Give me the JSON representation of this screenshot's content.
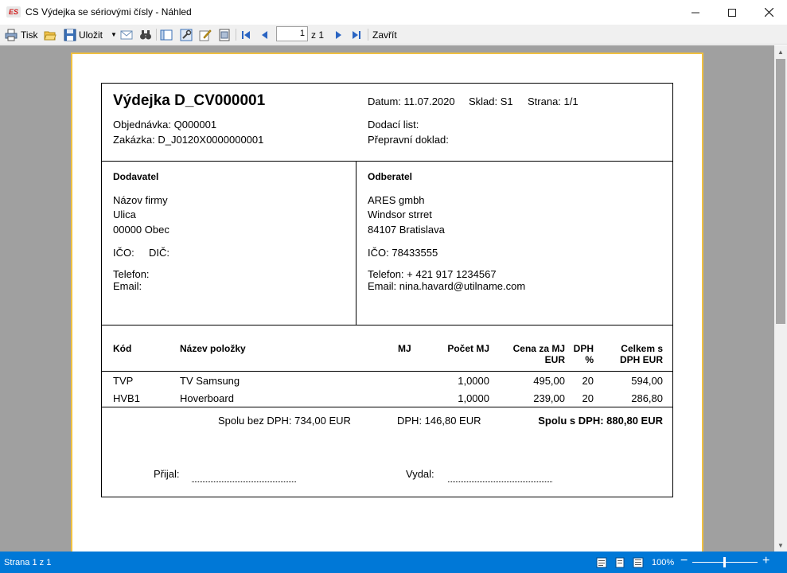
{
  "window": {
    "app_icon_text": "ES",
    "title": "CS Výdejka se sériovými čísly - Náhled"
  },
  "toolbar": {
    "print_label": "Tisk",
    "save_label": "Uložit",
    "page_input_value": "1",
    "page_of_label": "z 1",
    "close_label": "Zavřít"
  },
  "document": {
    "title": "Výdejka D_CV000001",
    "date_label": "Datum: 11.07.2020",
    "warehouse_label": "Sklad: S1",
    "page_label": "Strana: 1/1",
    "order_label": "Objednávka: Q000001",
    "contract_label": "Zakázka: D_J0120X0000000001",
    "delivery_note_label": "Dodací list:",
    "transport_doc_label": "Přepravní doklad:",
    "supplier": {
      "heading": "Dodavatel",
      "name": "Názov firmy",
      "street": "Ulica",
      "city": "00000 Obec",
      "ico": "IČO:",
      "dic": "DIČ:",
      "phone": "Telefon:",
      "email": "Email:"
    },
    "customer": {
      "heading": "Odberatel",
      "name": "ARES gmbh",
      "street": "Windsor strret",
      "city": "84107 Bratislava",
      "ico": "IČO: 78433555",
      "phone": "Telefon: + 421 917 1234567",
      "email": "Email: nina.havard@utilname.com"
    },
    "table": {
      "headers": {
        "code": "Kód",
        "name": "Název položky",
        "unit": "MJ",
        "qty": "Počet MJ",
        "price_line1": "Cena za MJ",
        "price_line2": "EUR",
        "vat_line1": "DPH",
        "vat_line2": "%",
        "total_line1": "Celkem s",
        "total_line2": "DPH EUR"
      },
      "rows": [
        {
          "code": "TVP",
          "name": "TV Samsung",
          "unit": "",
          "qty": "1,0000",
          "price": "495,00",
          "vat": "20",
          "total": "594,00"
        },
        {
          "code": "HVB1",
          "name": "Hoverboard",
          "unit": "",
          "qty": "1,0000",
          "price": "239,00",
          "vat": "20",
          "total": "286,80"
        }
      ]
    },
    "totals": {
      "without_vat": "Spolu bez DPH: 734,00 EUR",
      "vat": "DPH: 146,80 EUR",
      "with_vat": "Spolu s DPH: 880,80 EUR"
    },
    "signatures": {
      "received": "Přijal:",
      "issued": "Vydal:"
    }
  },
  "statusbar": {
    "page_status": "Strana 1 z 1",
    "zoom": "100%"
  },
  "colors": {
    "statusbar": "#0078d7",
    "viewer_background": "#a0a0a0",
    "page_border": "#f0c040"
  }
}
